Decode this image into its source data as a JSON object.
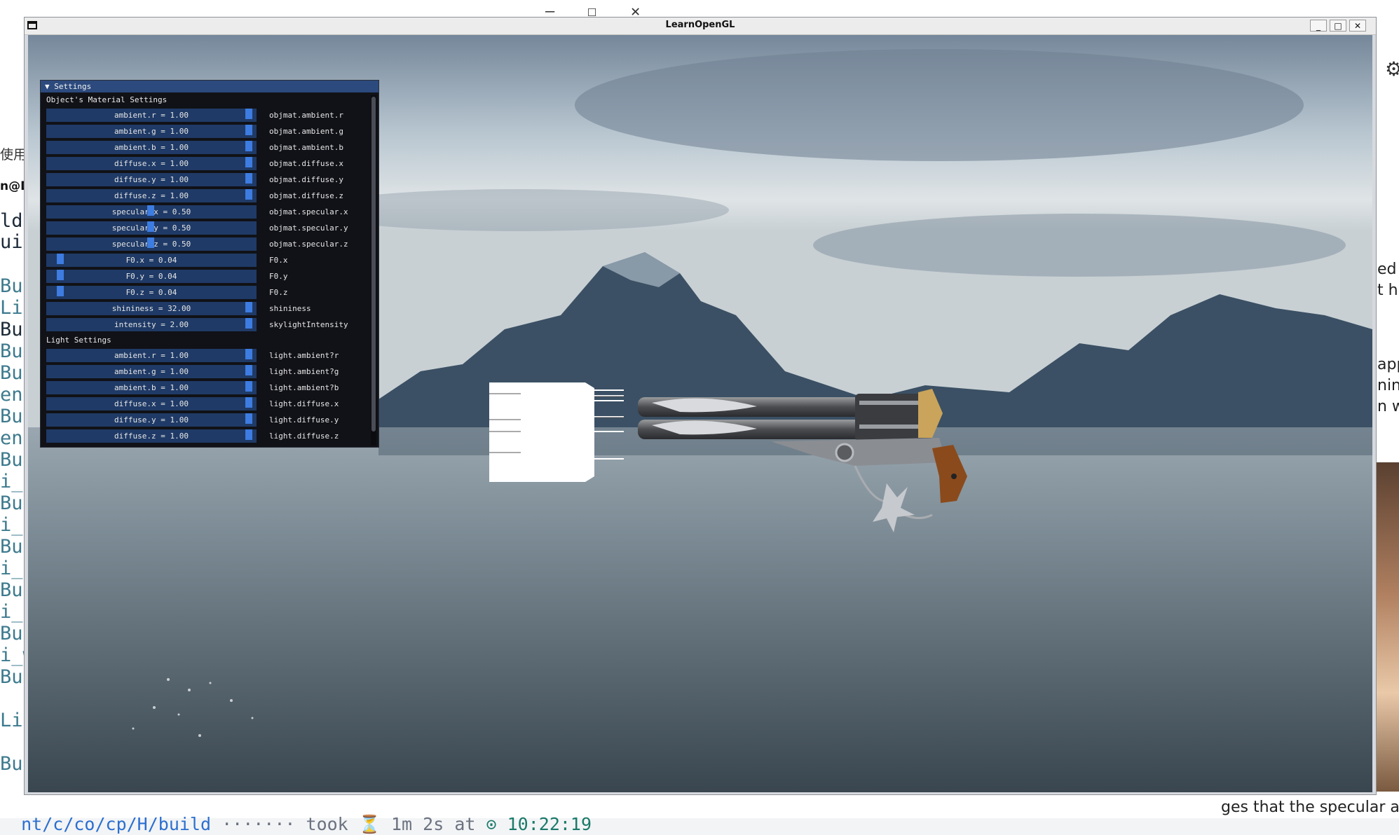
{
  "background_left": {
    "lines": [
      "使用",
      "n@D",
      "ld",
      "uil",
      "Bu",
      "Li",
      "Bu",
      "Bu",
      "Bu",
      "enc",
      "Bu",
      "enc",
      "Bu",
      "i_c",
      "Bu",
      "i_c",
      "Bu",
      "i_c",
      "Bu",
      "i_t",
      "Bu",
      "i_w",
      "Bu",
      "Li",
      "Bu"
    ],
    "window_controls": [
      "—",
      "☐",
      "✕"
    ]
  },
  "background_right": {
    "lines": [
      "ed t",
      "t h",
      "app",
      "nin",
      "n w"
    ],
    "bottom_text": "ges that the specular are"
  },
  "terminal": {
    "path": "nt/c/co/cp/H/build",
    "dots": " ······· ",
    "took": "took",
    "hourglass": "⏳",
    "duration": "1m 2s",
    "at": "at",
    "clock": "⊙",
    "time": "10:22:19"
  },
  "window": {
    "title": "LearnOpenGL",
    "minimize": "_",
    "maximize": "□",
    "close": "✕"
  },
  "settings": {
    "title": "▼ Settings",
    "material_section": "Object's Material Settings",
    "material_rows": [
      {
        "text": "ambient.r = 1.00",
        "label": "objmat.ambient.r",
        "value": 1.0
      },
      {
        "text": "ambient.g = 1.00",
        "label": "objmat.ambient.g",
        "value": 1.0
      },
      {
        "text": "ambient.b = 1.00",
        "label": "objmat.ambient.b",
        "value": 1.0
      },
      {
        "text": "diffuse.x = 1.00",
        "label": "objmat.diffuse.x",
        "value": 1.0
      },
      {
        "text": "diffuse.y = 1.00",
        "label": "objmat.diffuse.y",
        "value": 1.0
      },
      {
        "text": "diffuse.z = 1.00",
        "label": "objmat.diffuse.z",
        "value": 1.0
      },
      {
        "text": "specular.x = 0.50",
        "label": "objmat.specular.x",
        "value": 0.5
      },
      {
        "text": "specular.y = 0.50",
        "label": "objmat.specular.y",
        "value": 0.5
      },
      {
        "text": "specular.z = 0.50",
        "label": "objmat.specular.z",
        "value": 0.5
      },
      {
        "text": "F0.x = 0.04",
        "label": "F0.x",
        "value": 0.04
      },
      {
        "text": "F0.y = 0.04",
        "label": "F0.y",
        "value": 0.04
      },
      {
        "text": "F0.z = 0.04",
        "label": "F0.z",
        "value": 0.04
      },
      {
        "text": "shininess = 32.00",
        "label": "shininess",
        "value": 1.0
      },
      {
        "text": "intensity = 2.00",
        "label": "skylightIntensity",
        "value": 1.0
      }
    ],
    "light_section": "Light Settings",
    "light_rows": [
      {
        "text": "ambient.r = 1.00",
        "label": "light.ambient?r",
        "value": 1.0
      },
      {
        "text": "ambient.g = 1.00",
        "label": "light.ambient?g",
        "value": 1.0
      },
      {
        "text": "ambient.b = 1.00",
        "label": "light.ambient?b",
        "value": 1.0
      },
      {
        "text": "diffuse.x = 1.00",
        "label": "light.diffuse.x",
        "value": 1.0
      },
      {
        "text": "diffuse.y = 1.00",
        "label": "light.diffuse.y",
        "value": 1.0
      },
      {
        "text": "diffuse.z = 1.00",
        "label": "light.diffuse.z",
        "value": 1.0
      }
    ]
  },
  "colors": {
    "imgui_frame": "#1f3a66",
    "imgui_grab": "#3d7ce0",
    "imgui_title": "#2c4a7d",
    "terminal_path": "#2b6fd0"
  }
}
